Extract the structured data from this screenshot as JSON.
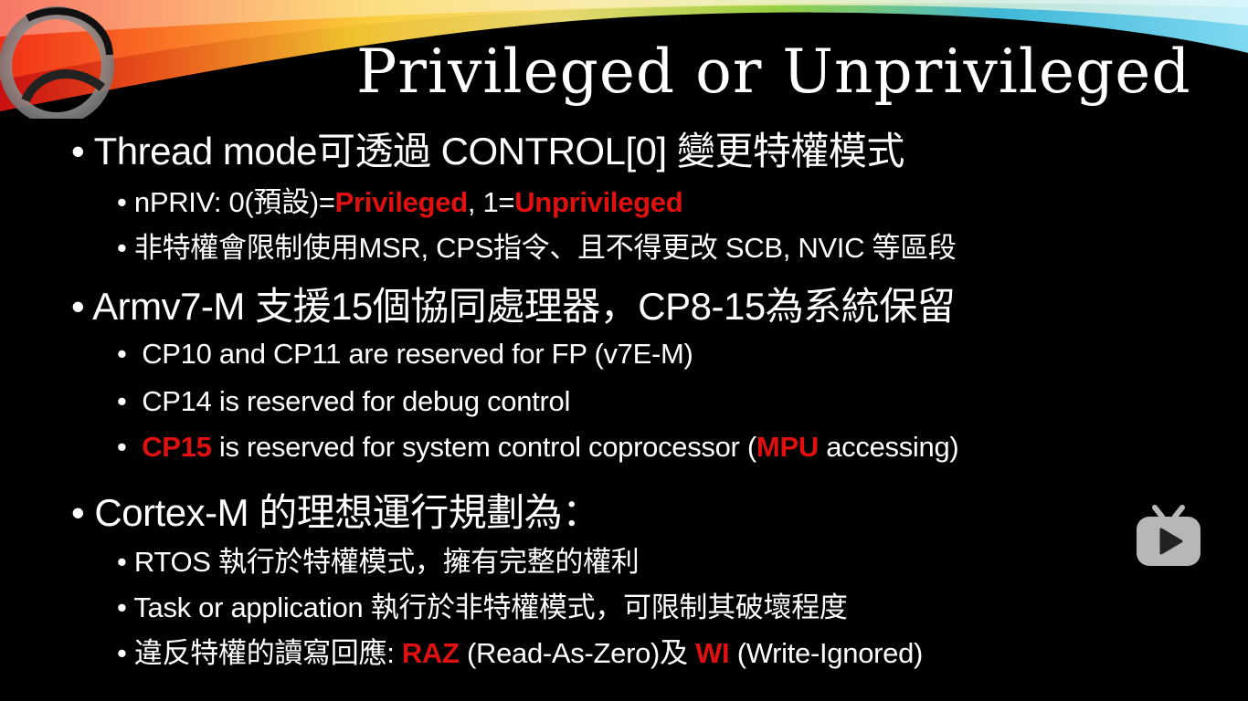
{
  "slide": {
    "title": "Privileged or Unprivileged",
    "bullet_glyph": "•",
    "colors": {
      "background": "#000000",
      "text": "#ffffff",
      "highlight": "#e01010"
    },
    "sections": [
      {
        "heading": "Thread mode可透過 CONTROL[0] 變更特權模式",
        "items": [
          {
            "parts": [
              "nPRIV: 0(預設)=",
              "Privileged",
              ", 1=",
              "Unprivileged"
            ]
          },
          {
            "parts": [
              "非特權會限制使用MSR, CPS指令、且不得更改 SCB, NVIC 等區段"
            ]
          }
        ]
      },
      {
        "heading": "Armv7-M 支援15個協同處理器，CP8-15為系統保留",
        "items": [
          {
            "parts": [
              "CP10 and CP11 are reserved for FP (v7E-M)"
            ]
          },
          {
            "parts": [
              "CP14 is reserved for debug control"
            ]
          },
          {
            "parts": [
              "CP15",
              " is reserved for system control coprocessor (",
              "MPU",
              " accessing)"
            ]
          }
        ]
      },
      {
        "heading": "Cortex-M 的理想運行規劃為：",
        "items": [
          {
            "parts": [
              "RTOS 執行於特權模式，擁有完整的權利"
            ]
          },
          {
            "parts": [
              "Task or application 執行於非特權模式，可限制其破壞程度"
            ]
          },
          {
            "parts": [
              "違反特權的讀寫回應: ",
              "RAZ",
              " (Read-As-Zero)及 ",
              "WI",
              " (Write-Ignored)"
            ]
          }
        ]
      }
    ]
  },
  "overlay": {
    "icon": "bilibili-tv-icon"
  }
}
